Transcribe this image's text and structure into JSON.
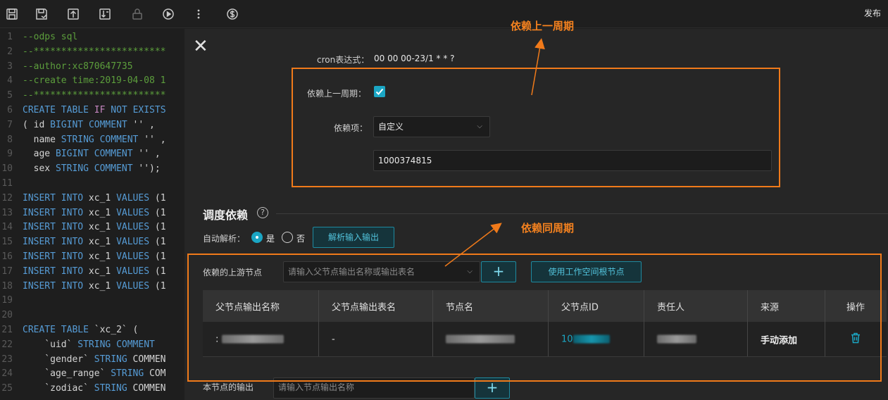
{
  "toolbar": {
    "icons": [
      "save-icon",
      "save-submit-icon",
      "upload-icon",
      "export-icon",
      "lock-icon",
      "run-icon",
      "more-icon",
      "cost-icon"
    ],
    "publish_label": "发布"
  },
  "editor": {
    "lines": [
      {
        "n": "1",
        "text": "--odps sql",
        "kind": "comment"
      },
      {
        "n": "2",
        "text": "--************************",
        "kind": "comment"
      },
      {
        "n": "3",
        "text": "--author:xc870647735",
        "kind": "comment"
      },
      {
        "n": "4",
        "text": "--create time:2019-04-08 1",
        "kind": "comment"
      },
      {
        "n": "5",
        "text": "--************************",
        "kind": "comment"
      },
      {
        "n": "6",
        "text": "CREATE TABLE IF NOT EXISTS",
        "kind": "ddl"
      },
      {
        "n": "7",
        "text": "( id BIGINT COMMENT '' ,",
        "kind": "col"
      },
      {
        "n": "8",
        "text": "  name STRING COMMENT '' ,",
        "kind": "col"
      },
      {
        "n": "9",
        "text": "  age BIGINT COMMENT '' ,",
        "kind": "col"
      },
      {
        "n": "10",
        "text": "  sex STRING COMMENT '');",
        "kind": "col"
      },
      {
        "n": "11",
        "text": "",
        "kind": "blank"
      },
      {
        "n": "12",
        "text": "INSERT INTO xc_1 VALUES (1",
        "kind": "insert"
      },
      {
        "n": "13",
        "text": "INSERT INTO xc_1 VALUES (1",
        "kind": "insert"
      },
      {
        "n": "14",
        "text": "INSERT INTO xc_1 VALUES (1",
        "kind": "insert"
      },
      {
        "n": "15",
        "text": "INSERT INTO xc_1 VALUES (1",
        "kind": "insert"
      },
      {
        "n": "16",
        "text": "INSERT INTO xc_1 VALUES (1",
        "kind": "insert"
      },
      {
        "n": "17",
        "text": "INSERT INTO xc_1 VALUES (1",
        "kind": "insert"
      },
      {
        "n": "18",
        "text": "INSERT INTO xc_1 VALUES (1",
        "kind": "insert"
      },
      {
        "n": "19",
        "text": "",
        "kind": "blank"
      },
      {
        "n": "20",
        "text": "",
        "kind": "blank"
      },
      {
        "n": "21",
        "text": "CREATE TABLE `xc_2` (",
        "kind": "ddl2"
      },
      {
        "n": "22",
        "text": "    `uid` STRING COMMENT",
        "kind": "col"
      },
      {
        "n": "23",
        "text": "    `gender` STRING COMMEN",
        "kind": "col"
      },
      {
        "n": "24",
        "text": "    `age_range` STRING COM",
        "kind": "col"
      },
      {
        "n": "25",
        "text": "    `zodiac` STRING COMMEN",
        "kind": "col"
      }
    ]
  },
  "settings": {
    "cron_label": "cron表达式：",
    "cron_value": "00 00 00-23/1 * * ?",
    "depend_last_label": "依赖上一周期：",
    "depend_last_checked": true,
    "depend_item_label": "依赖项：",
    "depend_item_value": "自定义",
    "depend_item_input": "1000374815"
  },
  "schedule": {
    "title": "调度依赖",
    "help": "?",
    "auto_parse_label": "自动解析：",
    "auto_parse_yes": "是",
    "auto_parse_no": "否",
    "parse_button": "解析输入输出",
    "upstream_label": "依赖的上游节点",
    "upstream_placeholder": "请输入父节点输出名称或输出表名",
    "add_label": "+",
    "root_button": "使用工作空间根节点",
    "output_label": "本节点的输出",
    "output_placeholder": "请输入节点输出名称"
  },
  "table": {
    "headers": [
      "父节点输出名称",
      "父节点输出表名",
      "节点名",
      "父节点ID",
      "责任人",
      "来源",
      "操作"
    ],
    "row": {
      "output_name_prefix": ":",
      "output_table": "-",
      "node_id_prefix": "10",
      "source": "手动添加"
    }
  },
  "annotations": {
    "top": "依赖上一周期",
    "middle": "依赖同周期"
  },
  "colors": {
    "accent": "#1ba6c4",
    "annotation": "#f07a1a",
    "bg": "#1e1e1e"
  }
}
